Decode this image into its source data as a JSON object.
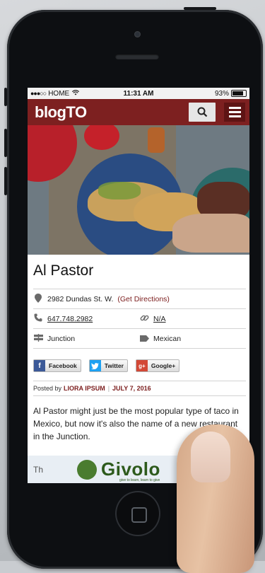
{
  "status_bar": {
    "signal": "●●●○○",
    "carrier": "HOME",
    "time": "11:31 AM",
    "battery": "93%",
    "battery_level": 0.93
  },
  "navbar": {
    "logo": "blogTO"
  },
  "article": {
    "title": "Al Pastor",
    "address": "2982 Dundas St. W.",
    "directions_link": "(Get Directions)",
    "phone": "647.748.2982",
    "website": "N/A",
    "neighbourhood": "Junction",
    "category": "Mexican",
    "social": {
      "facebook": "Facebook",
      "twitter": "Twitter",
      "google": "Google+"
    },
    "posted_by_label": "Posted by",
    "author": "LIORA IPSUM",
    "date": "JULY 7, 2016",
    "body": "Al Pastor might just be the most popular type of taco in Mexico, but now it's also the name of a new restaurant in the Junction."
  },
  "ad": {
    "prefix": "Th",
    "brand": "Givolo",
    "tagline": "give to learn, learn to give"
  },
  "colors": {
    "brand": "#7d2020"
  }
}
